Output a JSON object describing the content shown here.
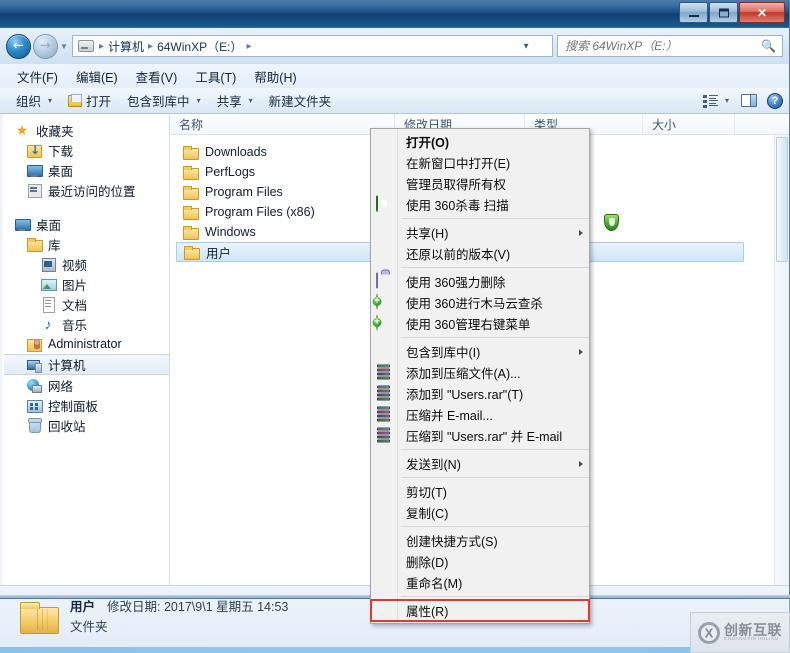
{
  "window": {
    "minimize_label": "–",
    "maximize_label": "□",
    "close_label": "✕"
  },
  "address": {
    "back_label": "←",
    "forward_label": "→",
    "history_caret": "▼",
    "crumbs": [
      "计算机",
      "64WinXP（E:）"
    ],
    "separator": "▸",
    "dropdown_caret": "▼",
    "refresh_label": "↻"
  },
  "search": {
    "placeholder": "搜索 64WinXP（E:）",
    "icon": "search-icon",
    "value": ""
  },
  "menubar": {
    "items": [
      {
        "label": "文件(F)"
      },
      {
        "label": "编辑(E)"
      },
      {
        "label": "查看(V)"
      },
      {
        "label": "工具(T)"
      },
      {
        "label": "帮助(H)"
      }
    ]
  },
  "toolbar": {
    "organize_label": "组织",
    "open_label": "打开",
    "include_library_label": "包含到库中",
    "share_label": "共享",
    "new_folder_label": "新建文件夹",
    "caret": "▾",
    "view_icon": "list-view-icon",
    "preview_pane_icon": "preview-pane-icon",
    "help_icon": "help-icon",
    "help_label": "?"
  },
  "navpane": {
    "groups": [
      {
        "items": [
          {
            "label": "收藏夹",
            "icon": "star-icon",
            "level": 1,
            "selected": false
          },
          {
            "label": "下载",
            "icon": "downloads-icon",
            "level": 2,
            "selected": false
          },
          {
            "label": "桌面",
            "icon": "desktop-icon",
            "level": 2,
            "selected": false
          },
          {
            "label": "最近访问的位置",
            "icon": "recent-places-icon",
            "level": 2,
            "selected": false
          }
        ]
      },
      {
        "items": [
          {
            "label": "桌面",
            "icon": "desktop-icon",
            "level": 1,
            "selected": false
          },
          {
            "label": "库",
            "icon": "library-icon",
            "level": 2,
            "selected": false
          },
          {
            "label": "视频",
            "icon": "videos-icon",
            "level": 3,
            "selected": false
          },
          {
            "label": "图片",
            "icon": "pictures-icon",
            "level": 3,
            "selected": false
          },
          {
            "label": "文档",
            "icon": "documents-icon",
            "level": 3,
            "selected": false
          },
          {
            "label": "音乐",
            "icon": "music-icon",
            "level": 3,
            "selected": false
          },
          {
            "label": "Administrator",
            "icon": "user-folder-icon",
            "level": 2,
            "selected": false
          },
          {
            "label": "计算机",
            "icon": "computer-icon",
            "level": 2,
            "selected": true
          },
          {
            "label": "网络",
            "icon": "network-icon",
            "level": 2,
            "selected": false
          },
          {
            "label": "控制面板",
            "icon": "control-panel-icon",
            "level": 2,
            "selected": false
          },
          {
            "label": "回收站",
            "icon": "recycle-bin-icon",
            "level": 2,
            "selected": false
          }
        ]
      }
    ]
  },
  "filelist": {
    "columns": [
      {
        "label": "名称",
        "key": "name"
      },
      {
        "label": "修改日期",
        "key": "modified"
      },
      {
        "label": "类型",
        "key": "type"
      },
      {
        "label": "大小",
        "key": "size"
      }
    ],
    "rows": [
      {
        "name": "Downloads",
        "icon": "folder-icon",
        "selected": false
      },
      {
        "name": "PerfLogs",
        "icon": "folder-icon",
        "selected": false
      },
      {
        "name": "Program Files",
        "icon": "folder-icon",
        "selected": false
      },
      {
        "name": "Program Files (x86)",
        "icon": "folder-icon",
        "selected": false
      },
      {
        "name": "Windows",
        "icon": "folder-icon",
        "selected": false
      },
      {
        "name": "用户",
        "icon": "folder-icon",
        "selected": true
      }
    ]
  },
  "details": {
    "name": "用户",
    "modified_label": "修改日期:",
    "modified_value": "2017\\9\\1 星期五 14:53",
    "type_value": "文件夹",
    "icon": "big-folder-icon"
  },
  "context_menu": {
    "items": [
      {
        "label": "打开(O)",
        "bold": true,
        "icon": null,
        "submenu": false,
        "highlight": false
      },
      {
        "label": "在新窗口中打开(E)",
        "bold": false,
        "icon": null,
        "submenu": false,
        "highlight": false
      },
      {
        "label": "管理员取得所有权",
        "bold": false,
        "icon": null,
        "submenu": false,
        "highlight": false
      },
      {
        "label": "使用 360杀毒 扫描",
        "bold": false,
        "icon": "shield-360-icon",
        "submenu": false,
        "highlight": false
      },
      {
        "separator": true
      },
      {
        "label": "共享(H)",
        "bold": false,
        "icon": null,
        "submenu": true,
        "highlight": false
      },
      {
        "label": "还原以前的版本(V)",
        "bold": false,
        "icon": null,
        "submenu": false,
        "highlight": false
      },
      {
        "separator": true
      },
      {
        "label": "使用 360强力删除",
        "bold": false,
        "icon": "box-360-icon",
        "submenu": false,
        "highlight": false
      },
      {
        "label": "使用 360进行木马云查杀",
        "bold": false,
        "icon": "plus-360-icon",
        "submenu": false,
        "highlight": false
      },
      {
        "label": "使用 360管理右键菜单",
        "bold": false,
        "icon": "plus-360-icon",
        "submenu": false,
        "highlight": false
      },
      {
        "separator": true
      },
      {
        "label": "包含到库中(I)",
        "bold": false,
        "icon": null,
        "submenu": true,
        "highlight": false
      },
      {
        "label": "添加到压缩文件(A)...",
        "bold": false,
        "icon": "winrar-icon",
        "submenu": false,
        "highlight": false
      },
      {
        "label": "添加到 \"Users.rar\"(T)",
        "bold": false,
        "icon": "winrar-icon",
        "submenu": false,
        "highlight": false
      },
      {
        "label": "压缩并 E-mail...",
        "bold": false,
        "icon": "winrar-icon",
        "submenu": false,
        "highlight": false
      },
      {
        "label": "压缩到 \"Users.rar\" 并 E-mail",
        "bold": false,
        "icon": "winrar-icon",
        "submenu": false,
        "highlight": false
      },
      {
        "separator": true
      },
      {
        "label": "发送到(N)",
        "bold": false,
        "icon": null,
        "submenu": true,
        "highlight": false
      },
      {
        "separator": true
      },
      {
        "label": "剪切(T)",
        "bold": false,
        "icon": null,
        "submenu": false,
        "highlight": false
      },
      {
        "label": "复制(C)",
        "bold": false,
        "icon": null,
        "submenu": false,
        "highlight": false
      },
      {
        "separator": true
      },
      {
        "label": "创建快捷方式(S)",
        "bold": false,
        "icon": null,
        "submenu": false,
        "highlight": false
      },
      {
        "label": "删除(D)",
        "bold": false,
        "icon": null,
        "submenu": false,
        "highlight": false
      },
      {
        "label": "重命名(M)",
        "bold": false,
        "icon": null,
        "submenu": false,
        "highlight": false
      },
      {
        "separator": true
      },
      {
        "label": "属性(R)",
        "bold": false,
        "icon": null,
        "submenu": false,
        "highlight": true
      }
    ]
  },
  "watermark": {
    "cn": "创新互联",
    "en": "CHUANGXIN HULIAN",
    "logo": "cx-logo-icon"
  },
  "colors": {
    "highlight_outline": "#e03a2c",
    "selection": "#cfe6fb",
    "titlebar": "#17497f"
  }
}
